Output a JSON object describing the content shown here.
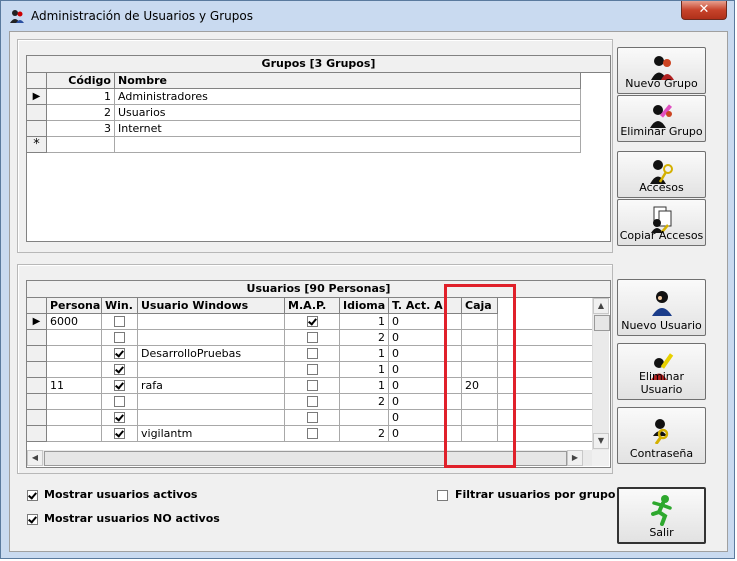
{
  "window": {
    "title": "Administración de Usuarios y Grupos",
    "close_label": "✕"
  },
  "groups": {
    "title": "Grupos [3 Grupos]",
    "columns": [
      "Código",
      "Nombre"
    ],
    "rows": [
      {
        "codigo": "1",
        "nombre": "Administradores"
      },
      {
        "codigo": "2",
        "nombre": "Usuarios"
      },
      {
        "codigo": "3",
        "nombre": "Internet"
      }
    ],
    "new_row_marker": "*",
    "current_row_marker": "▶"
  },
  "group_buttons": {
    "nuevo": "Nuevo Grupo",
    "eliminar": "Eliminar Grupo",
    "accesos": "Accesos",
    "copiar": "Copiar Accesos"
  },
  "users": {
    "title": "Usuarios [90 Personas]",
    "columns": [
      "Persona",
      "Win.",
      "Usuario Windows",
      "M.A.P.",
      "Idioma",
      "T. Act. A.",
      "Caja"
    ],
    "rows": [
      {
        "persona": "6000",
        "win": false,
        "usuario": "",
        "map": true,
        "idioma": "1",
        "tact": "0",
        "caja": ""
      },
      {
        "persona": "",
        "win": false,
        "usuario": "",
        "map": false,
        "idioma": "2",
        "tact": "0",
        "caja": ""
      },
      {
        "persona": "",
        "win": true,
        "usuario": "DesarrolloPruebas",
        "map": false,
        "idioma": "1",
        "tact": "0",
        "caja": ""
      },
      {
        "persona": "",
        "win": true,
        "usuario": "",
        "map": false,
        "idioma": "1",
        "tact": "0",
        "caja": ""
      },
      {
        "persona": "11",
        "win": true,
        "usuario": "rafa",
        "map": false,
        "idioma": "1",
        "tact": "0",
        "caja": "20"
      },
      {
        "persona": "",
        "win": false,
        "usuario": "",
        "map": false,
        "idioma": "2",
        "tact": "0",
        "caja": ""
      },
      {
        "persona": "",
        "win": true,
        "usuario": "",
        "map": false,
        "idioma": "",
        "tact": "0",
        "caja": ""
      },
      {
        "persona": "",
        "win": true,
        "usuario": "vigilantm",
        "map": false,
        "idioma": "2",
        "tact": "0",
        "caja": ""
      }
    ],
    "current_row_marker": "▶"
  },
  "user_buttons": {
    "nuevo": "Nuevo Usuario",
    "eliminar": "Eliminar Usuario",
    "contrasena": "Contraseña"
  },
  "options": {
    "mostrar_activos": {
      "label": "Mostrar usuarios activos",
      "checked": true
    },
    "mostrar_no_activos": {
      "label": "Mostrar usuarios NO activos",
      "checked": true
    },
    "filtrar_grupo": {
      "label": "Filtrar usuarios por grupo",
      "checked": false
    }
  },
  "salir_label": "Salir",
  "colors": {
    "highlight": "#e0202a"
  }
}
